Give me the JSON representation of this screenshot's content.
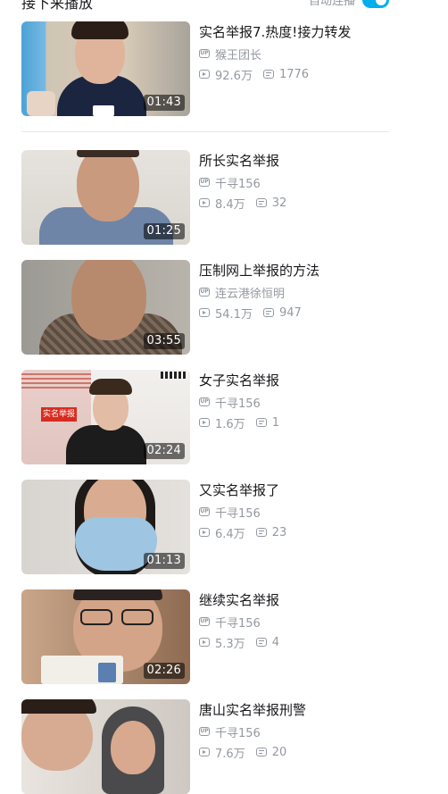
{
  "header": {
    "title": "接下来播放",
    "autoplay_label": "自动连播",
    "autoplay_on": true
  },
  "videos": [
    {
      "title": "实名举报7.热度!接力转发",
      "up": "猴王团长",
      "views": "92.6万",
      "danmaku": "1776",
      "duration": "01:43"
    },
    {
      "title": "所长实名举报",
      "up": "千寻156",
      "views": "8.4万",
      "danmaku": "32",
      "duration": "01:25"
    },
    {
      "title": "压制网上举报的方法",
      "up": "连云港徐恒明",
      "views": "54.1万",
      "danmaku": "947",
      "duration": "03:55"
    },
    {
      "title": "女子实名举报",
      "up": "千寻156",
      "views": "1.6万",
      "danmaku": "1",
      "duration": "02:24"
    },
    {
      "title": "又实名举报了",
      "up": "千寻156",
      "views": "6.4万",
      "danmaku": "23",
      "duration": "01:13"
    },
    {
      "title": "继续实名举报",
      "up": "千寻156",
      "views": "5.3万",
      "danmaku": "4",
      "duration": "02:26"
    },
    {
      "title": "唐山实名举报刑警",
      "up": "千寻156",
      "views": "7.6万",
      "danmaku": "20",
      "duration": ""
    }
  ],
  "thumb_text": {
    "banner": "实名举报"
  },
  "colors": {
    "accent": "#00aeec",
    "meta": "#9499a0",
    "title": "#18191c",
    "divider": "#e3e5e7"
  },
  "icons": {
    "up": "up-badge-icon",
    "views": "play-count-icon",
    "danmaku": "danmaku-icon"
  }
}
